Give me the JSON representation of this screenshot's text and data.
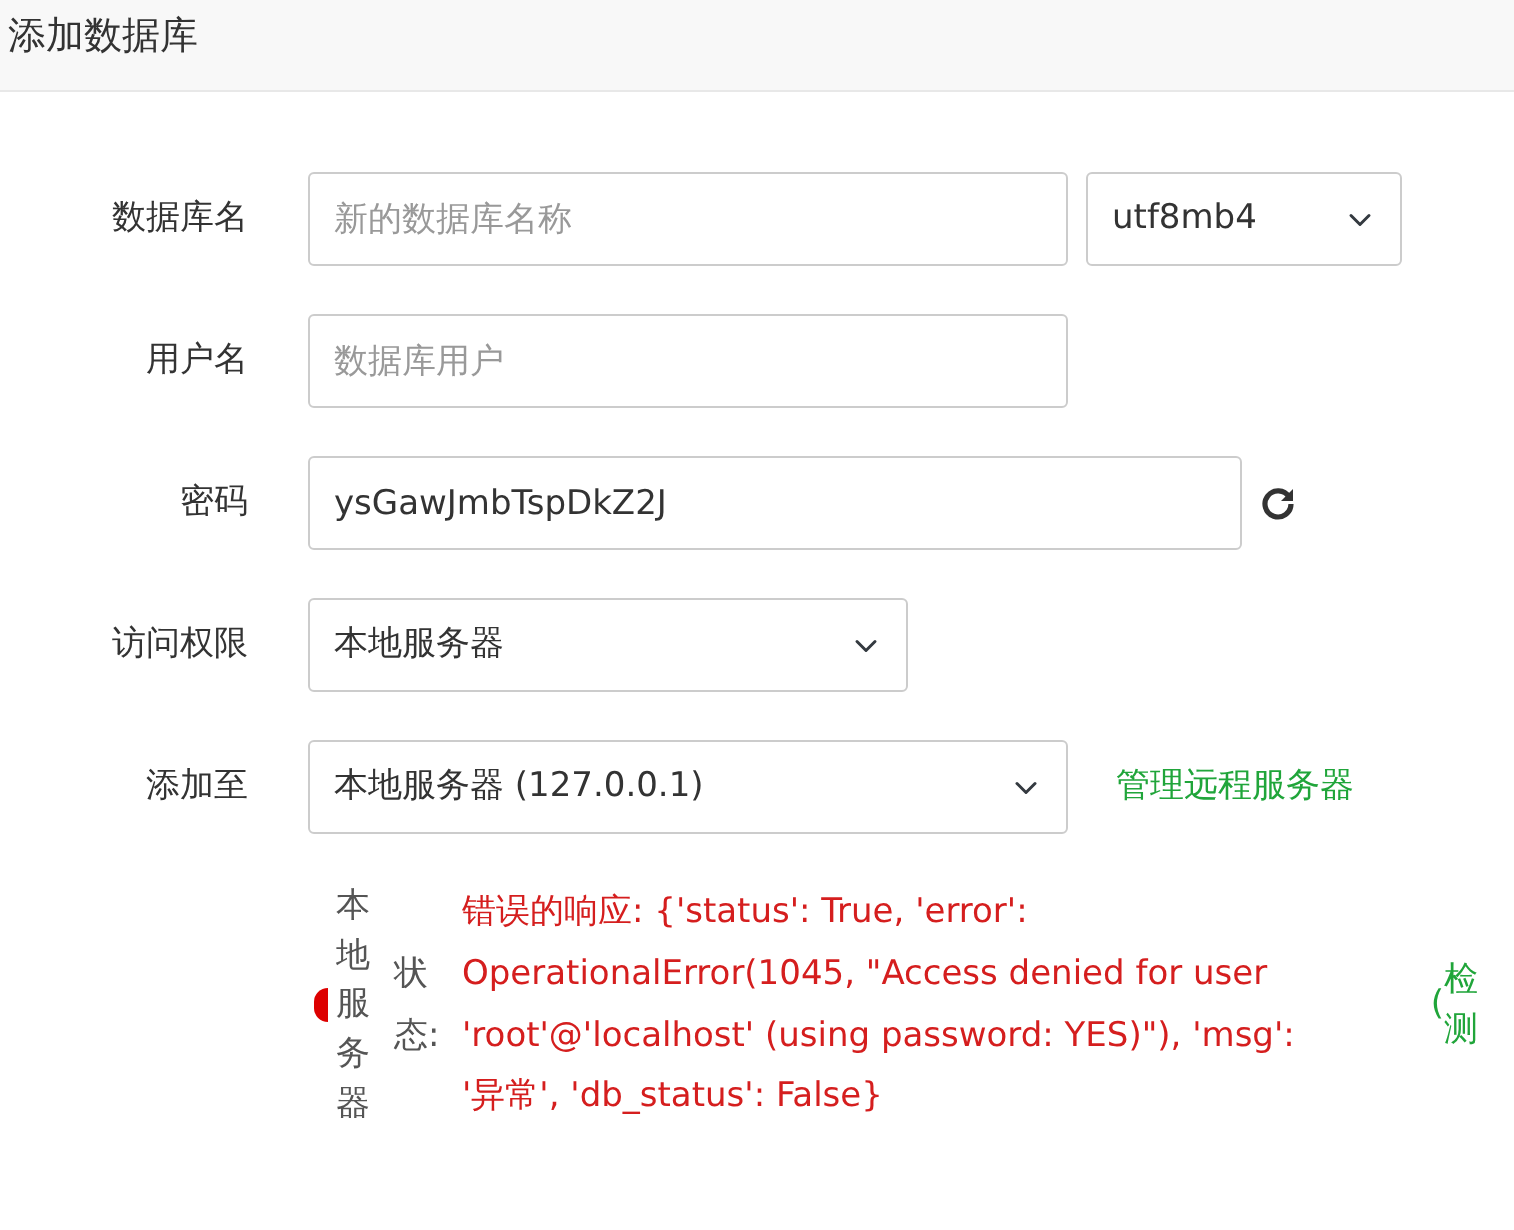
{
  "dialog": {
    "title": "添加数据库"
  },
  "fields": [
    {
      "label": "数据库名",
      "controls": [
        {
          "kind": "input",
          "placeholder": "新的数据库名称"
        },
        {
          "kind": "select",
          "value": "utf8mb4"
        }
      ]
    },
    {
      "label": "用户名",
      "controls": [
        {
          "kind": "input",
          "placeholder": "数据库用户"
        }
      ]
    },
    {
      "label": "密码",
      "controls": [
        {
          "kind": "input",
          "value": "ysGawJmbTspDkZ2J"
        },
        {
          "kind": "refresh"
        }
      ]
    },
    {
      "label": "访问权限",
      "controls": [
        {
          "kind": "select",
          "value": "本地服务器"
        }
      ]
    },
    {
      "label": "添加至",
      "controls": [
        {
          "kind": "select",
          "value": "本地服务器 (127.0.0.1)"
        },
        {
          "kind": "link",
          "text": "管理远程服务器"
        }
      ]
    }
  ],
  "status": {
    "server": "本地服务器",
    "label": "状态:",
    "message": "错误的响应: {'status': True, 'error': OperationalError(1045, \"Access denied for user 'root'@'localhost' (using password: YES)\"), 'msg': '异常', 'db_status': False}",
    "paren": "(",
    "action": "检测"
  }
}
